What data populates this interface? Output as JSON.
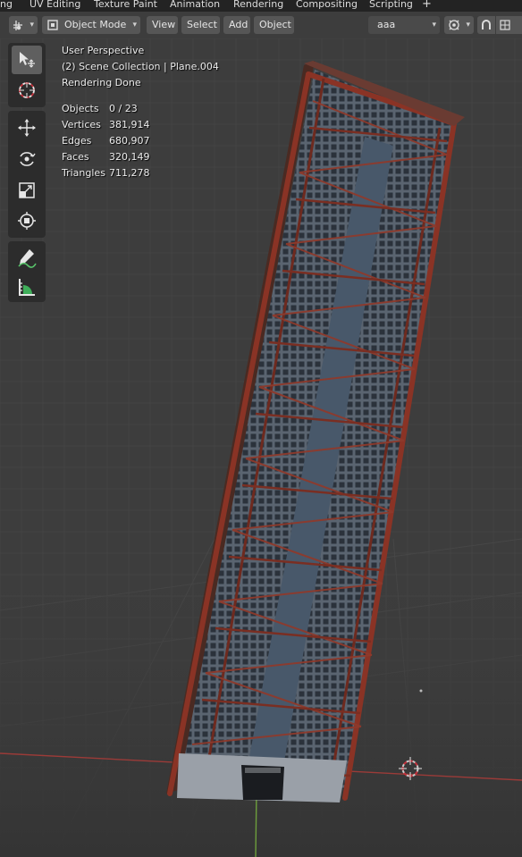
{
  "workspace_tabs": [
    {
      "label": "ng"
    },
    {
      "label": "UV Editing"
    },
    {
      "label": "Texture Paint"
    },
    {
      "label": "Animation"
    },
    {
      "label": "Rendering"
    },
    {
      "label": "Compositing"
    },
    {
      "label": "Scripting"
    },
    {
      "label": "+"
    }
  ],
  "header": {
    "mode_label": "Object Mode",
    "menus": [
      {
        "label": "View"
      },
      {
        "label": "Select"
      },
      {
        "label": "Add"
      },
      {
        "label": "Object"
      }
    ],
    "scene_label": "aaa"
  },
  "overlay": {
    "perspective": "User Perspective",
    "collection": "(2) Scene Collection | Plane.004",
    "status": "Rendering Done",
    "stats": [
      {
        "label": "Objects",
        "value": "0 / 23"
      },
      {
        "label": "Vertices",
        "value": "381,914"
      },
      {
        "label": "Edges",
        "value": "680,907"
      },
      {
        "label": "Faces",
        "value": "320,149"
      },
      {
        "label": "Triangles",
        "value": "711,278"
      }
    ]
  },
  "toolbar": {
    "tools": [
      {
        "name": "select-box-icon",
        "active": true
      },
      {
        "name": "cursor-icon",
        "active": false
      },
      {
        "name": "move-icon",
        "active": false
      },
      {
        "name": "rotate-icon",
        "active": false
      },
      {
        "name": "scale-icon",
        "active": false
      },
      {
        "name": "transform-icon",
        "active": false
      },
      {
        "name": "annotate-icon",
        "active": false
      },
      {
        "name": "measure-icon",
        "active": false
      }
    ]
  },
  "colors": {
    "background": "#3d3d3d",
    "frame_rust": "#7a2e22",
    "x_axis": "#9b3b38",
    "y_axis": "#6d9e3c"
  }
}
